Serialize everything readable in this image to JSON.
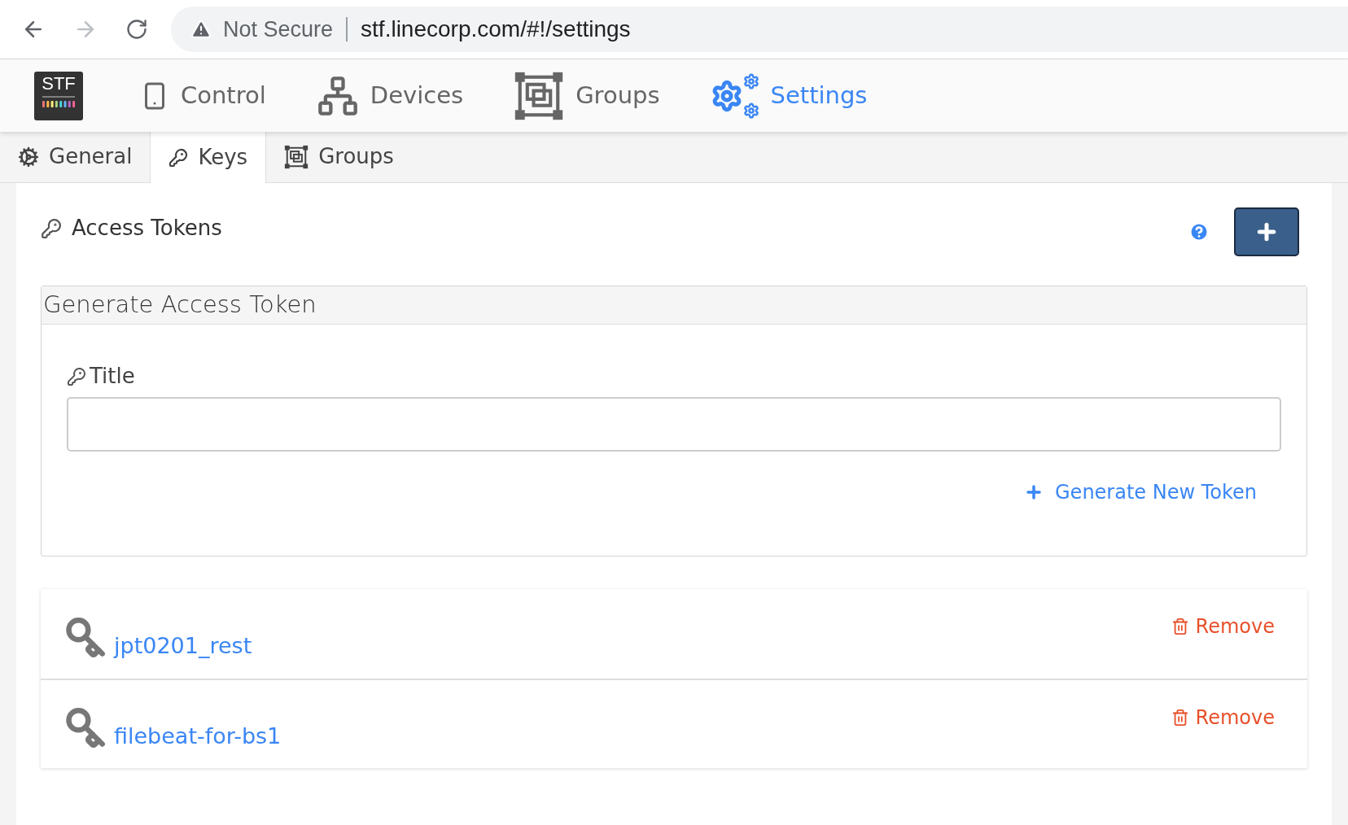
{
  "browser": {
    "security": "Not Secure",
    "url": "stf.linecorp.com/#!/settings",
    "forward_disabled": true
  },
  "nav": {
    "logo": "STF",
    "items": [
      {
        "label": "Control",
        "kind": "control",
        "selected": false
      },
      {
        "label": "Devices",
        "kind": "devices",
        "selected": false
      },
      {
        "label": "Groups",
        "kind": "groups",
        "selected": false
      },
      {
        "label": "Settings",
        "kind": "settings",
        "selected": true
      }
    ]
  },
  "tabs": [
    {
      "label": "General",
      "kind": "general",
      "selected": false
    },
    {
      "label": "Keys",
      "kind": "keys",
      "selected": true
    },
    {
      "label": "Groups",
      "kind": "groups",
      "selected": false
    }
  ],
  "section": {
    "title": "Access Tokens"
  },
  "generate_panel": {
    "title": "Generate Access Token",
    "field_label": "Title",
    "button": "Generate New Token"
  },
  "tokens": [
    {
      "name": "jpt0201_rest",
      "action": "Remove"
    },
    {
      "name": "filebeat-for-bs1",
      "action": "Remove"
    }
  ]
}
